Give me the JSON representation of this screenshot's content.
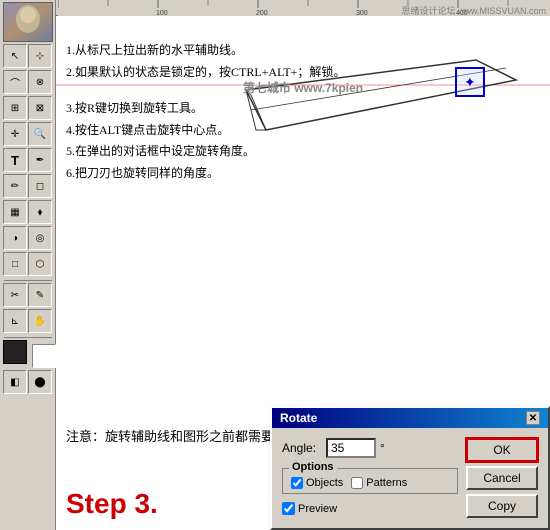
{
  "watermark": {
    "text": "思绪设计论坛 www.MISSVUAN.com"
  },
  "toolbar": {
    "tools": [
      {
        "name": "arrow",
        "icon": "↖",
        "label": "arrow-tool"
      },
      {
        "name": "select",
        "icon": "⊹",
        "label": "select-tool"
      },
      {
        "name": "move",
        "icon": "✛",
        "label": "move-tool"
      },
      {
        "name": "zoom",
        "icon": "🔍",
        "label": "zoom-tool"
      },
      {
        "name": "text",
        "icon": "T",
        "label": "text-tool"
      },
      {
        "name": "pen",
        "icon": "✒",
        "label": "pen-tool"
      },
      {
        "name": "brush",
        "icon": "✏",
        "label": "brush-tool"
      },
      {
        "name": "eraser",
        "icon": "◻",
        "label": "eraser-tool"
      },
      {
        "name": "crop",
        "icon": "⊡",
        "label": "crop-tool"
      },
      {
        "name": "eyedrop",
        "icon": "⊗",
        "label": "eyedrop-tool"
      },
      {
        "name": "gradient",
        "icon": "▦",
        "label": "gradient-tool"
      },
      {
        "name": "fill",
        "icon": "⬧",
        "label": "fill-tool"
      },
      {
        "name": "dodge",
        "icon": "◑",
        "label": "dodge-tool"
      },
      {
        "name": "blur",
        "icon": "◎",
        "label": "blur-tool"
      },
      {
        "name": "shape",
        "icon": "□",
        "label": "shape-tool"
      },
      {
        "name": "path",
        "icon": "⬡",
        "label": "path-tool"
      },
      {
        "name": "note",
        "icon": "✎",
        "label": "note-tool"
      },
      {
        "name": "measure",
        "icon": "⊾",
        "label": "measure-tool"
      },
      {
        "name": "scissors",
        "icon": "✂",
        "label": "scissors-tool"
      },
      {
        "name": "slice",
        "icon": "⊞",
        "label": "slice-tool"
      },
      {
        "name": "hand",
        "icon": "✋",
        "label": "hand-tool"
      },
      {
        "name": "rotate",
        "icon": "↻",
        "label": "rotate-tool"
      },
      {
        "name": "fgbg",
        "icon": "◈",
        "label": "fg-bg-tool"
      }
    ]
  },
  "instructions": [
    {
      "id": 1,
      "text": "1.从标尺上拉出新的水平辅助线。"
    },
    {
      "id": 2,
      "text": "2.如果默认的状态是锁定的，按CTRL+ALT+；解锁。"
    },
    {
      "id": 3,
      "text": "3.按R键切换到旋转工具。"
    },
    {
      "id": 4,
      "text": "4.按住ALT键点击旋转中心点。"
    },
    {
      "id": 5,
      "text": "5.在弹出的对话框中设定旋转角度。"
    },
    {
      "id": 6,
      "text": "6.把刀刃也旋转同样的角度。"
    }
  ],
  "watermark_text": "第七城市  www.7kpien",
  "note": {
    "text": "注意：旋转辅助线和图形之前都需要选中！"
  },
  "step_label": "Step 3.",
  "dialog": {
    "title": "Rotate",
    "angle_label": "Angle:",
    "angle_value": "35",
    "degree_symbol": "°",
    "options_label": "Options",
    "objects_label": "Objects",
    "patterns_label": "Patterns",
    "objects_checked": true,
    "patterns_checked": false,
    "preview_label": "Preview",
    "preview_checked": true,
    "ok_label": "OK",
    "cancel_label": "Cancel",
    "copy_label": "Copy"
  }
}
